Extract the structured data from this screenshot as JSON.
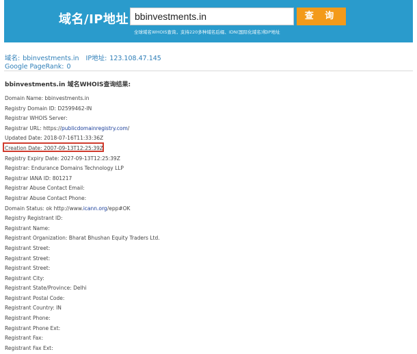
{
  "search": {
    "label": "域名/IP地址:",
    "value": "bbinvestments.in",
    "button_label": "查 询",
    "note": "全球域名WHOIS查询，支持220多种域名后缀、IDN(国际化域名)和IP地址"
  },
  "info": {
    "domain_label": "域名:",
    "domain_value": "bbinvestments.in",
    "ip_label": "IP地址:",
    "ip_value": "123.108.47.145",
    "pagerank_label": "Google PageRank:",
    "pagerank_value": "0"
  },
  "result_title": "bbinvestments.in 域名WHOIS查询结果:",
  "whois": [
    {
      "label": "Domain Name: bbinvestments.in"
    },
    {
      "label": "Registry Domain ID: D2599462-IN"
    },
    {
      "label": "Registrar WHOIS Server:"
    },
    {
      "label": "Registrar URL: https://",
      "link": "publicdomainregistry.com",
      "suffix": "/"
    },
    {
      "label": "Updated Date: 2018-07-16T11:33:36Z"
    },
    {
      "label": "Creation Date: 2007-09-13T12:25:39Z"
    },
    {
      "label": "Registry Expiry Date: 2027-09-13T12:25:39Z"
    },
    {
      "label": "Registrar: Endurance Domains Technology LLP"
    },
    {
      "label": "Registrar IANA ID: 801217"
    },
    {
      "label": "Registrar Abuse Contact Email:"
    },
    {
      "label": "Registrar Abuse Contact Phone:"
    },
    {
      "label": "Domain Status: ok http://www.",
      "link": "icann.org",
      "suffix": "/epp#OK"
    },
    {
      "label": "Registry Registrant ID:"
    },
    {
      "label": "Registrant Name:"
    },
    {
      "label": "Registrant Organization: Bharat Bhushan Equity Traders Ltd."
    },
    {
      "label": "Registrant Street:"
    },
    {
      "label": "Registrant Street:"
    },
    {
      "label": "Registrant Street:"
    },
    {
      "label": "Registrant City:"
    },
    {
      "label": "Registrant State/Province: Delhi"
    },
    {
      "label": "Registrant Postal Code:"
    },
    {
      "label": "Registrant Country: IN"
    },
    {
      "label": "Registrant Phone:"
    },
    {
      "label": "Registrant Phone Ext:"
    },
    {
      "label": "Registrant Fax:"
    },
    {
      "label": "Registrant Fax Ext:"
    }
  ],
  "colors": {
    "banner": "#2a9bcc",
    "button": "#f39a1a",
    "link": "#2f7fb8",
    "highlight": "#d03a2c"
  }
}
